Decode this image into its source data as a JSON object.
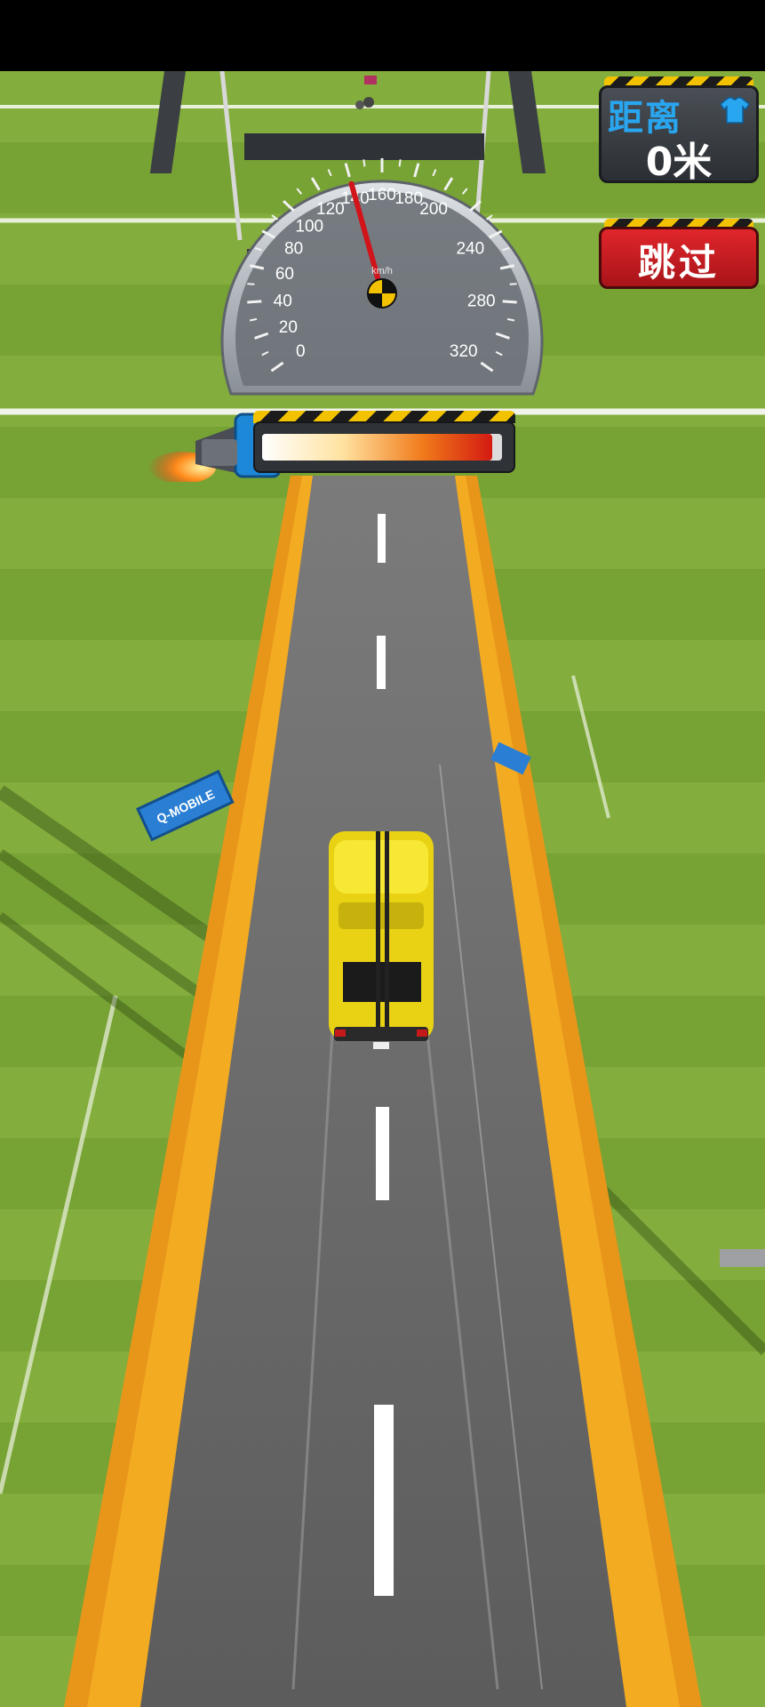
{
  "hud": {
    "distance_label": "距离",
    "distance_value": "0米",
    "skip_label": "跳过",
    "shirt_icon": "shirt-icon"
  },
  "speedometer": {
    "unit": "km/h",
    "ticks": [
      "0",
      "20",
      "40",
      "60",
      "80",
      "100",
      "120",
      "140",
      "160",
      "180",
      "200",
      "240",
      "280",
      "320"
    ],
    "needle_value": 140,
    "max": 320
  },
  "boost": {
    "level": 0.96,
    "icon": "rocket-thruster-icon"
  },
  "scene": {
    "banner_text": "Q-MOBILE",
    "colors": {
      "grass": "#7fa83a",
      "road": "#6e6e6e",
      "rail": "#f0a21a",
      "car": "#f3dc19",
      "hud_red": "#d11d22",
      "hud_blue": "#29a6f0"
    }
  }
}
